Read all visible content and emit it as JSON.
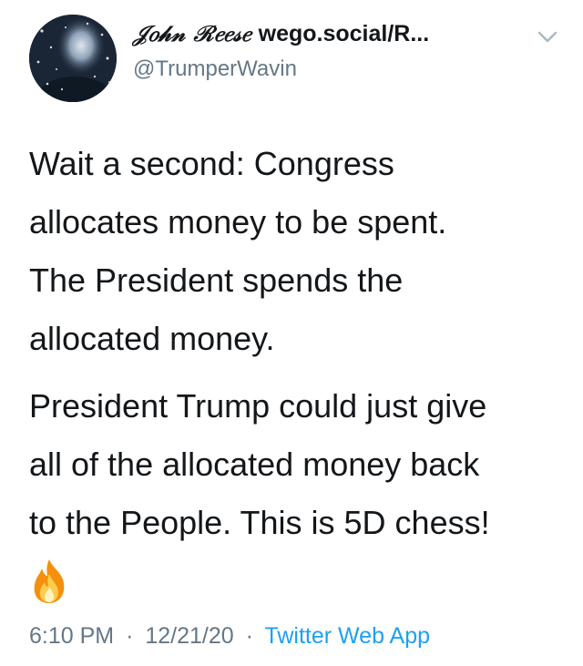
{
  "author": {
    "display_name": "𝒥𝑜𝒽𝓃 ℛ𝑒𝑒𝓈𝑒",
    "display_name_suffix": "wego.social/R...",
    "handle": "@TrumperWavin",
    "avatar_icon": "profile-photo"
  },
  "menu": {
    "icon": "chevron-down-icon"
  },
  "tweet": {
    "paragraphs": [
      "Wait a second: Congress\nallocates money to be spent.\nThe President spends the\nallocated money.",
      "President Trump could just give\nall of the allocated money back\nto the People. This is 5D chess!"
    ],
    "emoji": "fire-icon"
  },
  "meta": {
    "time": "6:10 PM",
    "separator": "·",
    "date": "12/21/20",
    "source": "Twitter Web App"
  },
  "colors": {
    "text": "#14171a",
    "secondary": "#657786",
    "link": "#1da1f2",
    "chevron": "#aab8c2"
  }
}
